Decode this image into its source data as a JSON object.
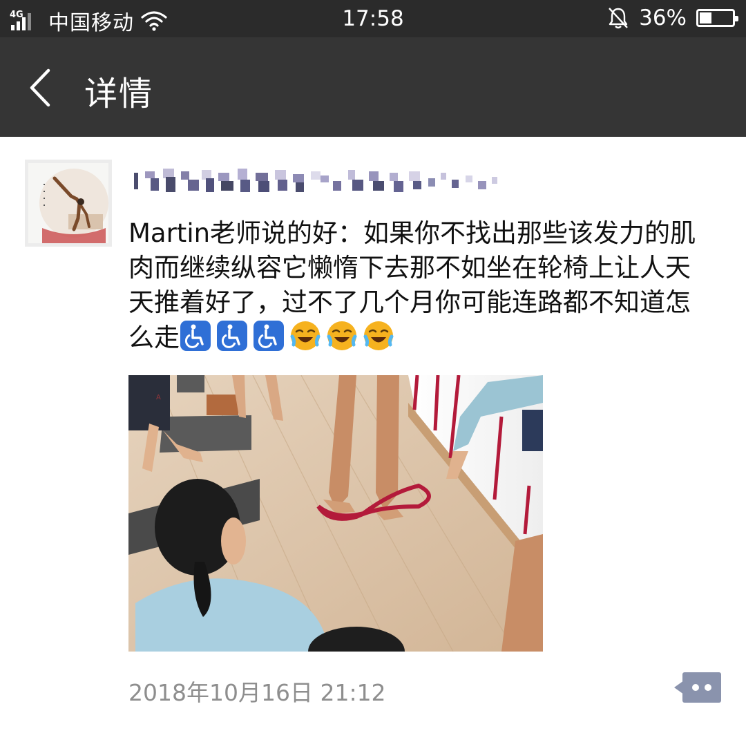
{
  "status_bar": {
    "network": "4G",
    "carrier": "中国移动",
    "time": "17:58",
    "battery_percent": "36%",
    "battery_level": 0.36,
    "icons": [
      "signal-icon",
      "wifi-icon",
      "bell-muted-icon",
      "battery-icon"
    ]
  },
  "header": {
    "back_icon": "chevron-left-icon",
    "title": "详情"
  },
  "post": {
    "text": "Martin老师说的好：如果你不找出那些该发力的肌肉而继续纵容它懒惰下去那不如坐在轮椅上让人天天推着好了，过不了几个月你可能连路都不知道怎么走",
    "emojis": [
      "wheelchair-emoji",
      "wheelchair-emoji",
      "wheelchair-emoji",
      "laugh-cry-emoji",
      "laugh-cry-emoji",
      "laugh-cry-emoji"
    ],
    "timestamp": "2018年10月16日 21:12",
    "more_icon": "comment-dots-icon"
  },
  "colors": {
    "status_bar_bg": "#2b2b2b",
    "title_bar_bg": "#353535",
    "text": "#111111",
    "timestamp": "#8e8e8e",
    "more_button": "#8a93ad",
    "wheelchair_emoji": "#2f6fd6",
    "laugh_emoji": "#f6b21f"
  }
}
